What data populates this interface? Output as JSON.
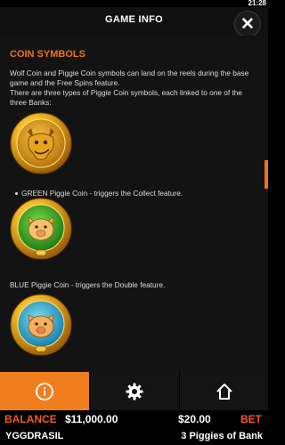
{
  "status": {
    "time": "21:28"
  },
  "header": {
    "title": "GAME INFO"
  },
  "content": {
    "section_title": "COIN SYMBOLS",
    "intro_line1": "Wolf Coin and Piggie Coin symbols can land on the reels during the base game and the Free Spins feature.",
    "intro_line2": "There are three types of Piggie Coin symbols, each linked to one of the three Banks:",
    "green_desc": "GREEN Piggie Coin - triggers the Collect feature.",
    "blue_desc": "BLUE Piggie Coin - triggers the Double feature."
  },
  "nav": {
    "items": [
      "info-icon",
      "gear-icon",
      "home-icon"
    ],
    "active": "info-icon"
  },
  "footer": {
    "balance_label": "BALANCE",
    "balance_value": "$11,000.00",
    "bet_value": "$20.00",
    "bet_label": "BET",
    "provider": "YGGDRASIL",
    "game_name": "3 Piggies of Bank"
  },
  "colors": {
    "accent": "#f07e1d",
    "section_title": "#f0731c",
    "label_red": "#f05a28",
    "coin_gold": "#e8a81c",
    "coin_green": "#3fae2a",
    "coin_blue": "#2fb3d6"
  }
}
